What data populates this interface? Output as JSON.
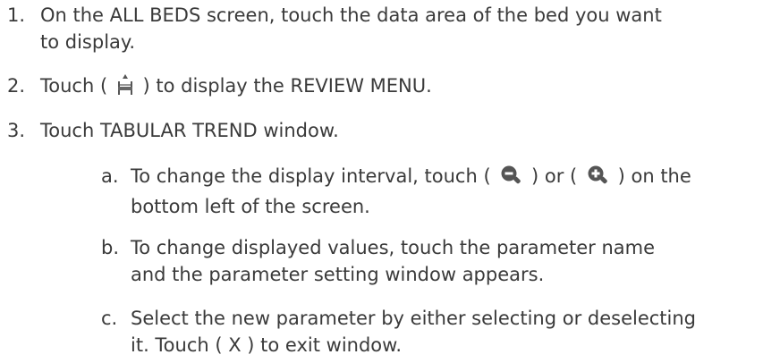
{
  "steps": [
    {
      "number": "1.",
      "line1": "On the ALL BEDS screen, touch the data area of the bed you want",
      "line2": "to display."
    },
    {
      "number": "2.",
      "before": "Touch (",
      "icon": "bed-review-icon",
      "after": ") to display the REVIEW MENU."
    },
    {
      "number": "3.",
      "text": "Touch TABULAR TREND window."
    }
  ],
  "substeps": [
    {
      "letter": "a.",
      "before": "To change the display interval, touch (",
      "icon1": "zoom-out-icon",
      "middle": ") or (",
      "icon2": "zoom-in-icon",
      "after": ") on the",
      "line2": "bottom left of the screen."
    },
    {
      "letter": "b.",
      "line1": "To change displayed values, touch the parameter name",
      "line2": "and the parameter setting window appears."
    },
    {
      "letter": "c.",
      "line1": "Select the new parameter by either selecting or deselecting",
      "line2": "it. Touch ( X ) to exit window."
    }
  ],
  "colors": {
    "text": "#3a3a3a",
    "icon": "#555555"
  }
}
